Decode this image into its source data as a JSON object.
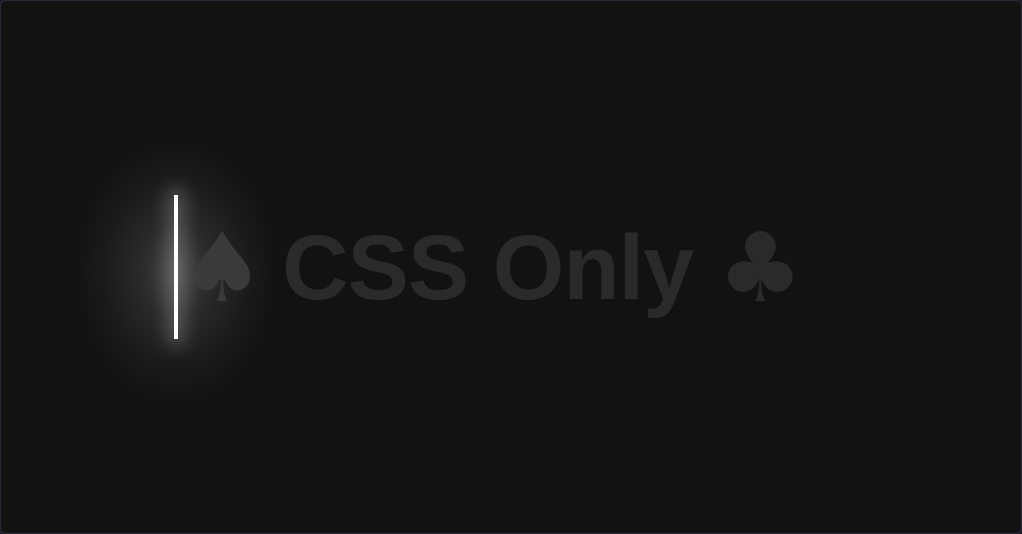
{
  "demo": {
    "left_symbol": "♠",
    "title": "CSS Only",
    "right_symbol": "♣"
  },
  "colors": {
    "background": "#121212",
    "text": "#2a2a2a",
    "cursor": "#ffffff"
  }
}
